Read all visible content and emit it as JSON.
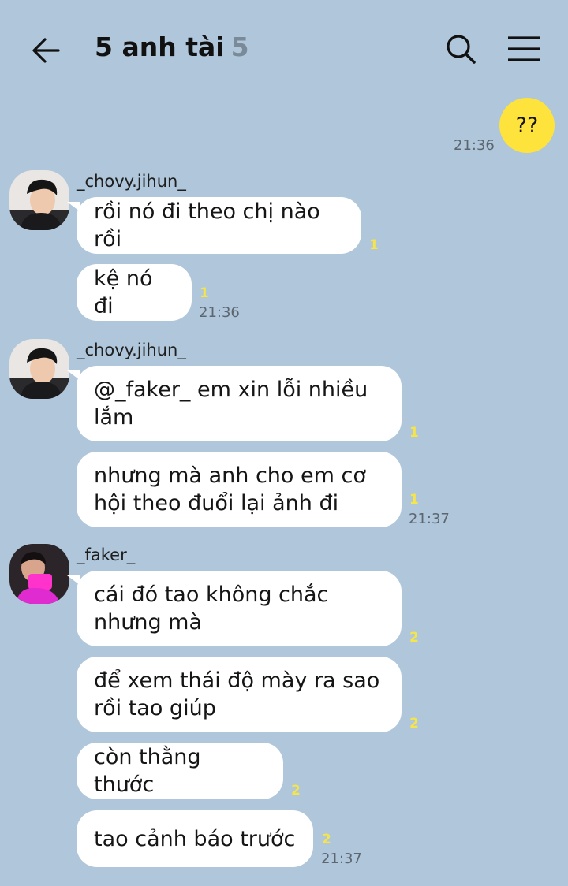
{
  "header": {
    "title": "5 anh tài",
    "member_count": "5",
    "back_icon": "arrow-left-icon",
    "search_icon": "search-icon",
    "menu_icon": "hamburger-menu-icon"
  },
  "colors": {
    "background": "#afc6db",
    "my_bubble": "#fde33c",
    "their_bubble": "#ffffff",
    "unread_count": "#f5e44a"
  },
  "messages": [
    {
      "sender": "me",
      "text": "??",
      "time": "21:36"
    },
    {
      "sender": "_chovy.jihun_",
      "text": "rồi nó đi theo chị nào rồi",
      "unread": "1"
    },
    {
      "sender": "_chovy.jihun_",
      "text": "kệ nó đi",
      "unread": "1",
      "time": "21:36"
    },
    {
      "sender": "_chovy.jihun_",
      "text": "@_faker_ em xin lỗi nhiều\nlắm",
      "unread": "1"
    },
    {
      "sender": "_chovy.jihun_",
      "text": "nhưng mà anh cho em cơ\nhội theo đuổi lại ảnh đi",
      "unread": "1",
      "time": "21:37"
    },
    {
      "sender": "_faker_",
      "text": "cái đó tao không chắc\nnhưng mà",
      "unread": "2"
    },
    {
      "sender": "_faker_",
      "text": "để xem thái độ mày ra sao\nrồi tao giúp",
      "unread": "2"
    },
    {
      "sender": "_faker_",
      "text": "còn thằng thước",
      "unread": "2"
    },
    {
      "sender": "_faker_",
      "text": "tao cảnh báo trước",
      "unread": "2",
      "time": "21:37"
    }
  ],
  "groups": [
    {
      "sender_name": "_chovy.jihun_"
    },
    {
      "sender_name": "_chovy.jihun_"
    },
    {
      "sender_name": "_faker_"
    }
  ]
}
